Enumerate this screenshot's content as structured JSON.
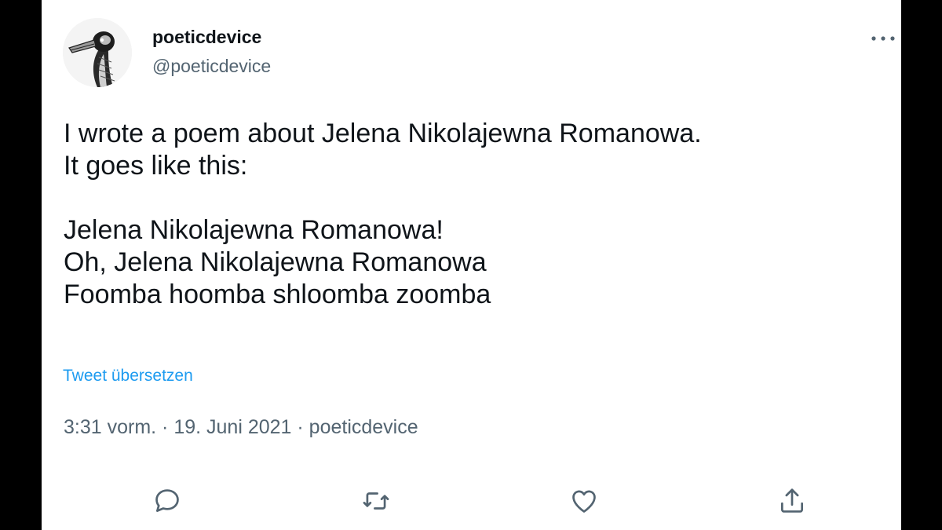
{
  "tweet": {
    "display_name": "poeticdevice",
    "handle": "@poeticdevice",
    "text_lines": [
      "I wrote a poem about Jelena Nikolajewna Romanowa.",
      "It goes like this:",
      "",
      "Jelena Nikolajewna Romanowa!",
      "Oh, Jelena Nikolajewna Romanowa",
      "Foomba hoomba shloomba zoomba"
    ],
    "translate_link": "Tweet übersetzen",
    "timestamp": "3:31 vorm. · 19. Juni 2021 · poeticdevice"
  },
  "icons": {
    "more": "more-horizontal-icon",
    "reply": "reply-icon",
    "retweet": "retweet-icon",
    "like": "like-icon",
    "share": "share-icon"
  },
  "colors": {
    "text": "#0f1419",
    "secondary": "#536471",
    "link": "#1d9bf0",
    "frame": "#000000"
  }
}
